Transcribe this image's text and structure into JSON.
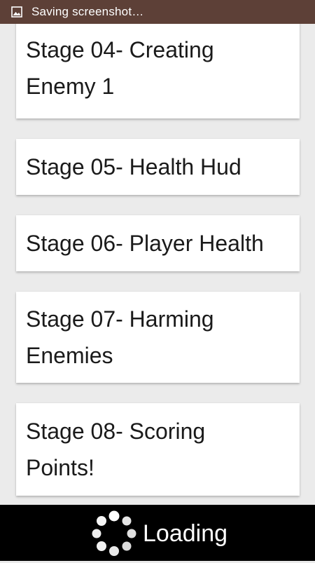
{
  "status_bar": {
    "icon": "image-icon",
    "text": "Saving screenshot…",
    "background": "#5d4037"
  },
  "stages": [
    {
      "title_line1": "Stage 04- Creating",
      "title_line2": "Enemy 1"
    },
    {
      "title_line1": "Stage 05- Health Hud",
      "title_line2": ""
    },
    {
      "title_line1": "Stage 06- Player Health",
      "title_line2": ""
    },
    {
      "title_line1": "Stage 07- Harming",
      "title_line2": "Enemies"
    },
    {
      "title_line1": "Stage 08- Scoring",
      "title_line2": "Points!"
    }
  ],
  "loading": {
    "icon": "spinner-icon",
    "label": "Loading"
  }
}
